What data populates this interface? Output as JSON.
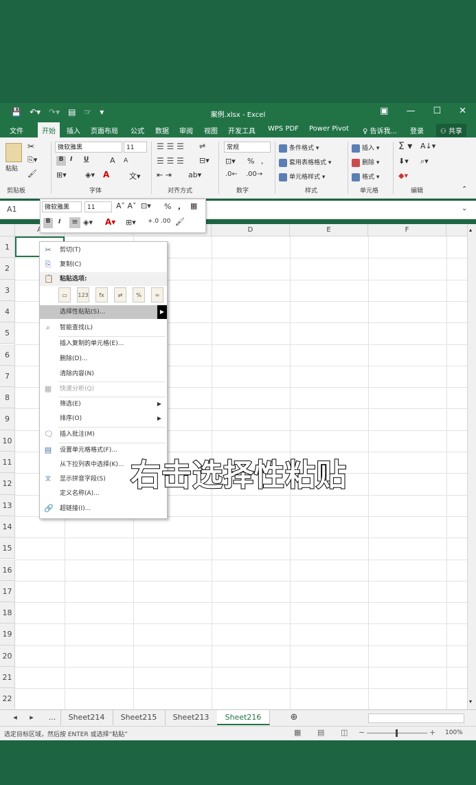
{
  "window": {
    "title": "案例.xlsx - Excel",
    "qat_icons": [
      "save-icon",
      "undo-icon",
      "redo-icon",
      "form-icon",
      "touch-icon"
    ]
  },
  "menu_tabs": [
    "文件",
    "开始",
    "插入",
    "页面布局",
    "公式",
    "数据",
    "审阅",
    "视图",
    "开发工具",
    "WPS PDF",
    "Power Pivot"
  ],
  "tell_me": "告诉我...",
  "login": "登录",
  "share": "共享",
  "ribbon": {
    "paste_label": "粘贴",
    "font_name": "微软雅黑",
    "font_size": "11",
    "bold": "B",
    "italic": "I",
    "underline": "U",
    "grow": "A",
    "shrink": "A",
    "number_format": "常规",
    "percent": "%",
    "comma": ",",
    "cond_format": "条件格式",
    "table_format": "套用表格格式",
    "cell_style": "单元格样式",
    "insert": "插入",
    "delete": "删除",
    "format": "格式",
    "sum": "Σ",
    "groups": [
      "剪贴板",
      "字体",
      "对齐方式",
      "数字",
      "样式",
      "单元格",
      "编辑"
    ]
  },
  "namebox": "A1",
  "mini_toolbar": {
    "font_name": "微软雅黑",
    "font_size": "11",
    "bold": "B",
    "italic": "I",
    "percent": "%",
    "comma": ","
  },
  "columns": [
    "A",
    "B",
    "C",
    "D",
    "E",
    "F"
  ],
  "rows": [
    "1",
    "2",
    "3",
    "4",
    "5",
    "6",
    "7",
    "8",
    "9",
    "10",
    "11",
    "12",
    "13",
    "14",
    "15",
    "16",
    "17",
    "18",
    "19",
    "20",
    "21",
    "22"
  ],
  "context_menu": {
    "cut": "剪切(T)",
    "copy": "复制(C)",
    "paste_options": "粘贴选项:",
    "paste_special": "选择性粘贴(S)...",
    "smart_lookup": "智能查找(L)",
    "insert_copied": "插入复制的单元格(E)...",
    "delete": "删除(D)...",
    "clear": "清除内容(N)",
    "quick_analysis": "快速分析(Q)",
    "filter": "筛选(E)",
    "sort": "排序(O)",
    "insert_comment": "插入批注(M)",
    "format_cells": "设置单元格格式(F)...",
    "pick_list": "从下拉列表中选择(K)...",
    "phonetic": "显示拼音字段(S)",
    "define_name": "定义名称(A)...",
    "hyperlink": "超链接(I)..."
  },
  "subtitle": "右击选择性粘贴",
  "sheet_tabs": [
    "...",
    "Sheet214",
    "Sheet215",
    "Sheet213",
    "Sheet216"
  ],
  "active_sheet": "Sheet216",
  "status_text": "选定目标区域，然后按 ENTER 或选择“粘贴”",
  "zoom": "100%",
  "accent_color": "#217346"
}
